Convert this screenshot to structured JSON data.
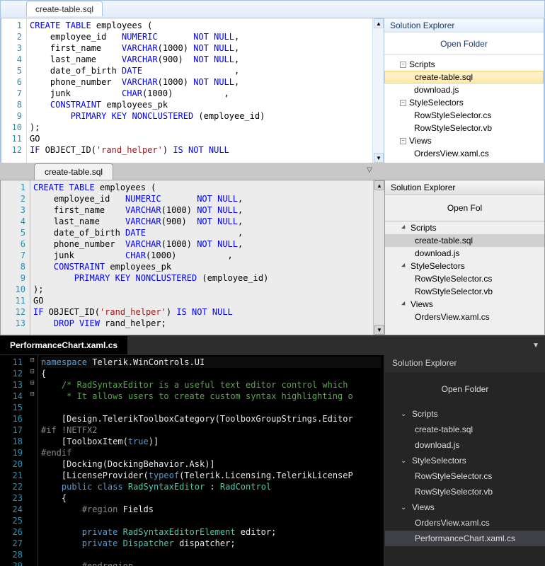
{
  "panes": [
    {
      "theme": "blue",
      "tab_title": "create-table.sql",
      "line_start": 1,
      "code_lines": [
        {
          "segs": [
            {
              "t": "CREATE TABLE",
              "c": "kw"
            },
            {
              "t": " employees ("
            }
          ]
        },
        {
          "segs": [
            {
              "t": "    employee_id   "
            },
            {
              "t": "NUMERIC",
              "c": "kw"
            },
            {
              "t": "       "
            },
            {
              "t": "NOT NULL",
              "c": "kw"
            },
            {
              "t": ","
            }
          ]
        },
        {
          "segs": [
            {
              "t": "    first_name    "
            },
            {
              "t": "VARCHAR",
              "c": "kw"
            },
            {
              "t": "(1000) "
            },
            {
              "t": "NOT NULL",
              "c": "kw"
            },
            {
              "t": ","
            }
          ]
        },
        {
          "segs": [
            {
              "t": "    last_name     "
            },
            {
              "t": "VARCHAR",
              "c": "kw"
            },
            {
              "t": "(900)  "
            },
            {
              "t": "NOT NULL",
              "c": "kw"
            },
            {
              "t": ","
            }
          ]
        },
        {
          "segs": [
            {
              "t": "    date_of_birth "
            },
            {
              "t": "DATE",
              "c": "kw"
            },
            {
              "t": "                  ,"
            }
          ]
        },
        {
          "segs": [
            {
              "t": "    phone_number  "
            },
            {
              "t": "VARCHAR",
              "c": "kw"
            },
            {
              "t": "(1000) "
            },
            {
              "t": "NOT NULL",
              "c": "kw"
            },
            {
              "t": ","
            }
          ]
        },
        {
          "segs": [
            {
              "t": "    junk          "
            },
            {
              "t": "CHAR",
              "c": "kw"
            },
            {
              "t": "(1000)          ,"
            }
          ]
        },
        {
          "segs": [
            {
              "t": "    "
            },
            {
              "t": "CONSTRAINT",
              "c": "kw"
            },
            {
              "t": " employees_pk"
            }
          ]
        },
        {
          "segs": [
            {
              "t": "        "
            },
            {
              "t": "PRIMARY KEY NONCLUSTERED",
              "c": "kw"
            },
            {
              "t": " (employee_id)"
            }
          ]
        },
        {
          "segs": [
            {
              "t": ");"
            }
          ]
        },
        {
          "segs": [
            {
              "t": "GO"
            }
          ]
        },
        {
          "segs": [
            {
              "t": "IF",
              "c": "kw"
            },
            {
              "t": " OBJECT_ID("
            },
            {
              "t": "'rand_helper'",
              "c": "str"
            },
            {
              "t": ") "
            },
            {
              "t": "IS NOT NULL",
              "c": "kw"
            }
          ]
        }
      ],
      "solution_explorer": {
        "title": "Solution Explorer",
        "open_folder": "Open Folder",
        "nodes": [
          {
            "label": "Scripts",
            "level": 1,
            "exp": true
          },
          {
            "label": "create-table.sql",
            "level": 2,
            "selected": true
          },
          {
            "label": "download.js",
            "level": 2
          },
          {
            "label": "StyleSelectors",
            "level": 1,
            "exp": true
          },
          {
            "label": "RowStyleSelector.cs",
            "level": 2
          },
          {
            "label": "RowStyleSelector.vb",
            "level": 2
          },
          {
            "label": "Views",
            "level": 1,
            "exp": true
          },
          {
            "label": "OrdersView.xaml.cs",
            "level": 2,
            "cut": true
          }
        ]
      }
    },
    {
      "theme": "gray",
      "tab_title": "create-table.sql",
      "line_start": 1,
      "code_lines": [
        {
          "segs": [
            {
              "t": "CREATE TABLE",
              "c": "kw"
            },
            {
              "t": " employees ("
            }
          ]
        },
        {
          "segs": [
            {
              "t": "    employee_id   "
            },
            {
              "t": "NUMERIC",
              "c": "kw"
            },
            {
              "t": "       "
            },
            {
              "t": "NOT NULL",
              "c": "kw"
            },
            {
              "t": ","
            }
          ]
        },
        {
          "segs": [
            {
              "t": "    first_name    "
            },
            {
              "t": "VARCHAR",
              "c": "kw"
            },
            {
              "t": "(1000) "
            },
            {
              "t": "NOT NULL",
              "c": "kw"
            },
            {
              "t": ","
            }
          ]
        },
        {
          "segs": [
            {
              "t": "    last_name     "
            },
            {
              "t": "VARCHAR",
              "c": "kw"
            },
            {
              "t": "(900)  "
            },
            {
              "t": "NOT NULL",
              "c": "kw"
            },
            {
              "t": ","
            }
          ]
        },
        {
          "segs": [
            {
              "t": "    date_of_birth "
            },
            {
              "t": "DATE",
              "c": "kw"
            },
            {
              "t": "                  ,"
            }
          ]
        },
        {
          "segs": [
            {
              "t": "    phone_number  "
            },
            {
              "t": "VARCHAR",
              "c": "kw"
            },
            {
              "t": "(1000) "
            },
            {
              "t": "NOT NULL",
              "c": "kw"
            },
            {
              "t": ","
            }
          ]
        },
        {
          "segs": [
            {
              "t": "    junk          "
            },
            {
              "t": "CHAR",
              "c": "kw"
            },
            {
              "t": "(1000)          ,"
            }
          ]
        },
        {
          "segs": [
            {
              "t": "    "
            },
            {
              "t": "CONSTRAINT",
              "c": "kw"
            },
            {
              "t": " employees_pk"
            }
          ]
        },
        {
          "segs": [
            {
              "t": "        "
            },
            {
              "t": "PRIMARY KEY NONCLUSTERED",
              "c": "kw"
            },
            {
              "t": " (employee_id)"
            }
          ]
        },
        {
          "segs": [
            {
              "t": ");"
            }
          ]
        },
        {
          "segs": [
            {
              "t": "GO"
            }
          ]
        },
        {
          "segs": [
            {
              "t": "IF",
              "c": "kw"
            },
            {
              "t": " OBJECT_ID("
            },
            {
              "t": "'rand_helper'",
              "c": "str"
            },
            {
              "t": ") "
            },
            {
              "t": "IS NOT NULL",
              "c": "kw"
            }
          ]
        },
        {
          "segs": [
            {
              "t": "    "
            },
            {
              "t": "DROP VIEW",
              "c": "kw"
            },
            {
              "t": " rand_helper;"
            }
          ]
        }
      ],
      "solution_explorer": {
        "title": "Solution Explorer",
        "open_folder": "Open Fol",
        "nodes": [
          {
            "label": "Scripts",
            "level": 1,
            "exp": true
          },
          {
            "label": "create-table.sql",
            "level": 2,
            "selected": true
          },
          {
            "label": "download.js",
            "level": 2
          },
          {
            "label": "StyleSelectors",
            "level": 1,
            "exp": true
          },
          {
            "label": "RowStyleSelector.cs",
            "level": 2
          },
          {
            "label": "RowStyleSelector.vb",
            "level": 2
          },
          {
            "label": "Views",
            "level": 1,
            "exp": true
          },
          {
            "label": "OrdersView.xaml.cs",
            "level": 2
          }
        ]
      }
    },
    {
      "theme": "dark",
      "tab_title": "PerformanceChart.xaml.cs",
      "line_start": 11,
      "fold_marks": {
        "12": "-",
        "14": "-",
        "24": "-",
        "25": "-"
      },
      "code_lines": [
        {
          "hl": true,
          "segs": [
            {
              "t": "namespace",
              "c": "kw-d"
            },
            {
              "t": " Telerik.WinControls.UI"
            }
          ]
        },
        {
          "segs": [
            {
              "t": "{"
            }
          ]
        },
        {
          "segs": [
            {
              "t": "    "
            },
            {
              "t": "/* RadSyntaxEditor is a useful text editor control which",
              "c": "cm-d"
            }
          ]
        },
        {
          "segs": [
            {
              "t": "     "
            },
            {
              "t": "* It allows users to create custom syntax highlighting o",
              "c": "cm-d"
            }
          ]
        },
        {
          "segs": []
        },
        {
          "segs": [
            {
              "t": "    [Design.TelerikToolboxCategory(ToolboxGroupStrings.Editor"
            }
          ]
        },
        {
          "segs": [
            {
              "t": "#if !NETFX2",
              "c": "dir-d"
            }
          ]
        },
        {
          "segs": [
            {
              "t": "    [ToolboxItem("
            },
            {
              "t": "true",
              "c": "kw-d"
            },
            {
              "t": ")]"
            }
          ]
        },
        {
          "segs": [
            {
              "t": "#endif",
              "c": "dir-d"
            }
          ]
        },
        {
          "segs": [
            {
              "t": "    [Docking(DockingBehavior.Ask)]"
            }
          ]
        },
        {
          "segs": [
            {
              "t": "    [LicenseProvider("
            },
            {
              "t": "typeof",
              "c": "kw-d"
            },
            {
              "t": "(Telerik.Licensing.TelerikLicenseP"
            }
          ]
        },
        {
          "segs": [
            {
              "t": "    "
            },
            {
              "t": "public class",
              "c": "kw-d"
            },
            {
              "t": " "
            },
            {
              "t": "RadSyntaxEditor",
              "c": "ty-d"
            },
            {
              "t": " : "
            },
            {
              "t": "RadControl",
              "c": "ty-d"
            }
          ]
        },
        {
          "segs": [
            {
              "t": "    {"
            }
          ]
        },
        {
          "segs": [
            {
              "t": "        "
            },
            {
              "t": "#region",
              "c": "dir-d"
            },
            {
              "t": " Fields"
            }
          ]
        },
        {
          "segs": []
        },
        {
          "segs": [
            {
              "t": "        "
            },
            {
              "t": "private",
              "c": "kw-d"
            },
            {
              "t": " "
            },
            {
              "t": "RadSyntaxEditorElement",
              "c": "ty-d"
            },
            {
              "t": " editor;"
            }
          ]
        },
        {
          "segs": [
            {
              "t": "        "
            },
            {
              "t": "private",
              "c": "kw-d"
            },
            {
              "t": " "
            },
            {
              "t": "Dispatcher",
              "c": "ty-d"
            },
            {
              "t": " dispatcher;"
            }
          ]
        },
        {
          "segs": []
        },
        {
          "segs": [
            {
              "t": "        "
            },
            {
              "t": "#endregion",
              "c": "dir-d"
            }
          ]
        }
      ],
      "solution_explorer": {
        "title": "Solution Explorer",
        "open_folder": "Open Folder",
        "nodes": [
          {
            "label": "Scripts",
            "level": 1,
            "exp": true
          },
          {
            "label": "create-table.sql",
            "level": 2
          },
          {
            "label": "download.js",
            "level": 2
          },
          {
            "label": "StyleSelectors",
            "level": 1,
            "exp": true
          },
          {
            "label": "RowStyleSelector.cs",
            "level": 2
          },
          {
            "label": "RowStyleSelector.vb",
            "level": 2
          },
          {
            "label": "Views",
            "level": 1,
            "exp": true
          },
          {
            "label": "OrdersView.xaml.cs",
            "level": 2
          },
          {
            "label": "PerformanceChart.xaml.cs",
            "level": 2,
            "selected": true
          }
        ]
      }
    }
  ]
}
